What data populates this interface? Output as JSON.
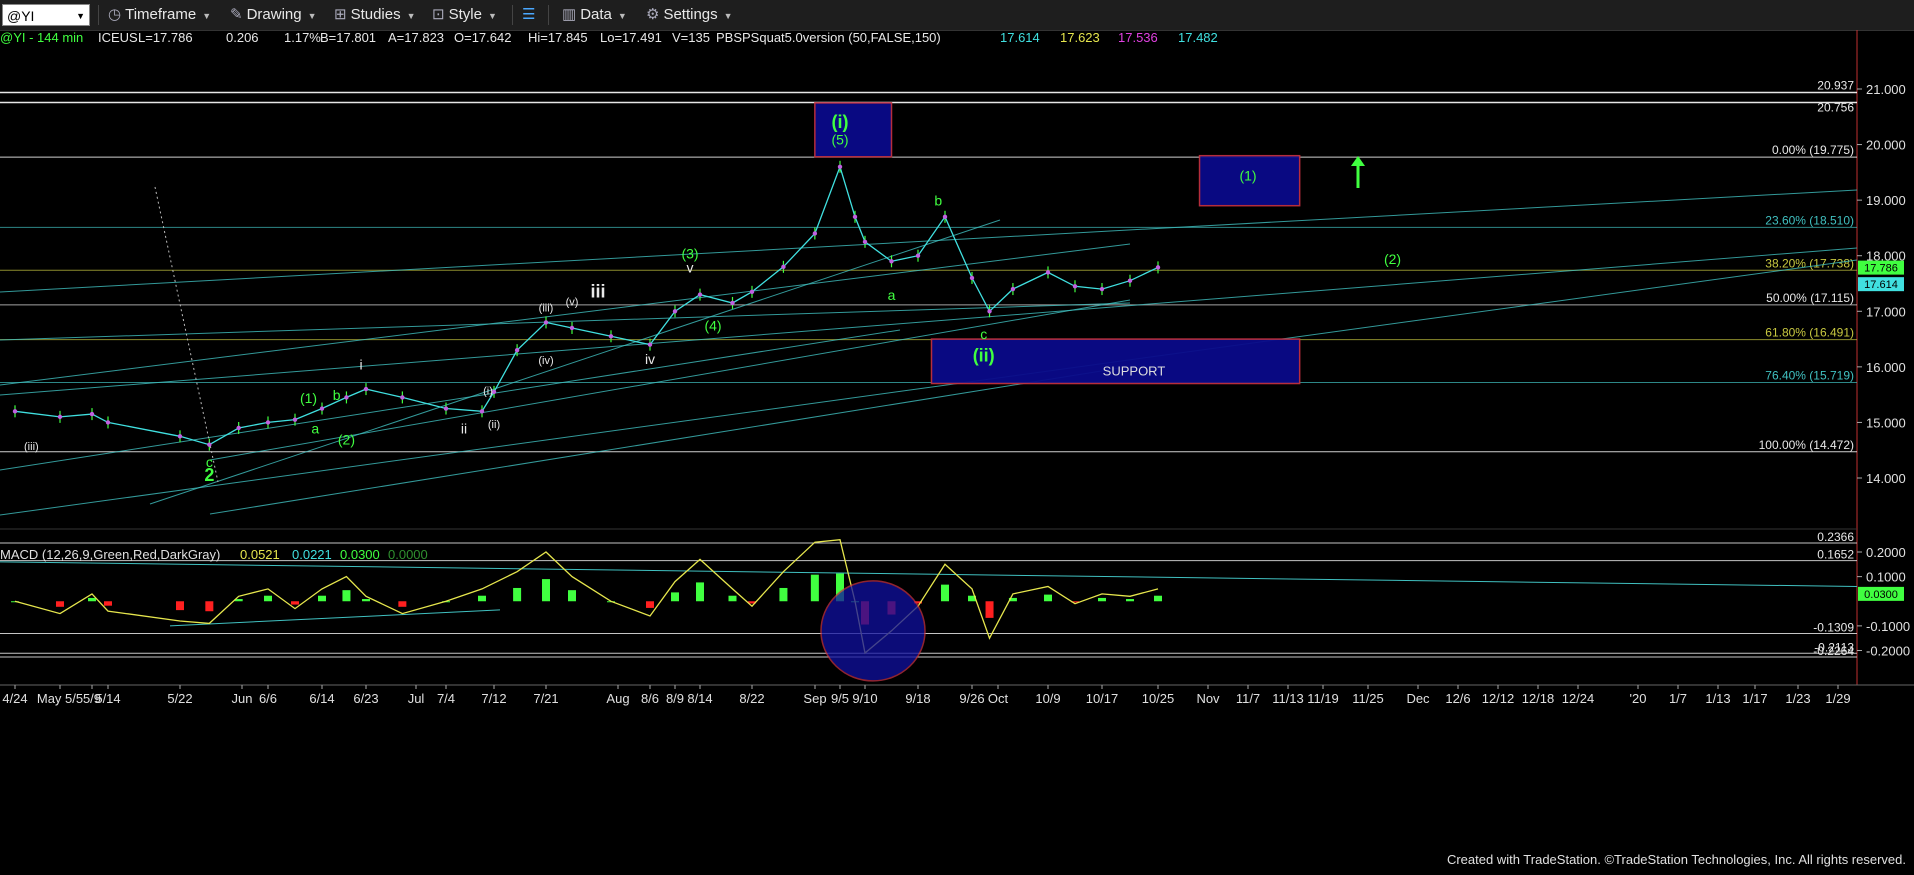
{
  "toolbar": {
    "symbol": "@YI",
    "timeframe_label": "Timeframe",
    "drawing_label": "Drawing",
    "studies_label": "Studies",
    "style_label": "Style",
    "data_label": "Data",
    "settings_label": "Settings"
  },
  "header": {
    "symbol_info": "@YI - 144 min",
    "exchange": "ICEUS",
    "last": "L=17.786",
    "change": "0.206",
    "change_pct": "1.17%",
    "bid": "B=17.801",
    "ask": "A=17.823",
    "open": "O=17.642",
    "high": "Hi=17.845",
    "low": "Lo=17.491",
    "volume": "V=135",
    "indicator": "PBSPSquat5.0version (50,FALSE,150)",
    "ind_values": [
      "17.614",
      "17.623",
      "17.536",
      "17.482"
    ],
    "ind_colors": [
      "#40e0e0",
      "#e6e64d",
      "#e040e0",
      "#40e0e0"
    ]
  },
  "macd_header": {
    "label": "MACD (12,26,9,Green,Red,DarkGray)",
    "values": [
      "0.0521",
      "0.0221",
      "0.0300",
      "0.0000"
    ],
    "colors": [
      "#e6e64d",
      "#40e0e0",
      "#40ff40",
      "#2f8f2f"
    ]
  },
  "footer": "Created with TradeStation. ©TradeStation Technologies, Inc. All rights reserved.",
  "colors": {
    "background": "#000000",
    "price_bars": "#40e0e0",
    "wave_green": "#40ff40",
    "wave_white": "#e8e8e8",
    "trendline": "#40c0c0",
    "box_fill": "#0a0a8a",
    "macd_pos": "#40ff40",
    "macd_neg": "#ff2020"
  },
  "chart_data": [
    {
      "type": "line",
      "title": "@YI - 144 min",
      "x_tick_labels": [
        "4/24",
        "May 5/5",
        "5/9",
        "5/14",
        "5/22",
        "Jun",
        "6/6",
        "6/14",
        "6/23",
        "Jul",
        "7/4",
        "7/12",
        "7/21",
        "Aug",
        "8/6",
        "8/9",
        "8/14",
        "8/22",
        "Sep",
        "9/5",
        "9/10",
        "9/18",
        "9/26",
        "Oct",
        "10/9",
        "10/17",
        "10/25",
        "Nov",
        "11/7",
        "11/13",
        "11/19",
        "11/25",
        "Dec",
        "12/6",
        "12/12",
        "12/18",
        "12/24",
        "'20",
        "1/7",
        "1/13",
        "1/17",
        "1/23",
        "1/29"
      ],
      "y_tick_labels": [
        "21.000",
        "20.000",
        "19.000",
        "18.000",
        "17.000",
        "16.000",
        "15.000",
        "14.000"
      ],
      "ylim": [
        13.25,
        21.45
      ],
      "series": [
        {
          "x": [
            "4/24",
            "5/5",
            "5/9",
            "5/14",
            "5/22",
            "5/27",
            "6/1",
            "6/6",
            "6/10",
            "6/14",
            "6/19",
            "6/23",
            "6/28",
            "7/4",
            "7/10",
            "7/12",
            "7/16",
            "7/21",
            "7/25",
            "7/31",
            "8/6",
            "8/9",
            "8/14",
            "8/19",
            "8/22",
            "8/27",
            "9/1",
            "9/5",
            "9/8",
            "9/10",
            "9/14",
            "9/18",
            "9/22",
            "9/26",
            "9/29",
            "10/3",
            "10/9",
            "10/13",
            "10/17",
            "10/21",
            "10/25"
          ],
          "values": [
            15.2,
            15.1,
            15.15,
            15.0,
            14.75,
            14.6,
            14.9,
            15.0,
            15.05,
            15.25,
            15.45,
            15.6,
            15.45,
            15.25,
            15.2,
            15.55,
            16.3,
            16.8,
            16.7,
            16.55,
            16.4,
            17.0,
            17.3,
            17.15,
            17.35,
            17.8,
            18.4,
            19.6,
            18.7,
            18.25,
            17.9,
            18.0,
            18.7,
            17.6,
            17.0,
            17.4,
            17.7,
            17.45,
            17.4,
            17.55,
            17.79
          ]
        }
      ],
      "levels": [
        {
          "label": "20.937",
          "value": 20.937
        },
        {
          "label": "20.756",
          "value": 20.756
        },
        {
          "label": "0.00% (19.775)",
          "value": 19.775
        },
        {
          "label": "23.60% (18.510)",
          "value": 18.51
        },
        {
          "label": "38.20% (17.738)",
          "value": 17.738
        },
        {
          "label": "50.00% (17.115)",
          "value": 17.115
        },
        {
          "label": "61.80% (16.491)",
          "value": 16.491
        },
        {
          "label": "76.40% (15.719)",
          "value": 15.719
        },
        {
          "label": "100.00% (14.472)",
          "value": 14.472
        }
      ],
      "price_markers": [
        "17.786",
        "17.614"
      ],
      "boxes": [
        {
          "label": "(i)",
          "sublabel": "(5)",
          "x0": "9/1",
          "x1": "9/14",
          "y0": 19.78,
          "y1": 20.75
        },
        {
          "label": "(1)",
          "x0": "10/31",
          "x1": "11/15",
          "y0": 18.9,
          "y1": 19.8
        },
        {
          "label": "SUPPORT",
          "x0": "9/20",
          "x1": "11/15",
          "y0": 15.7,
          "y1": 16.5
        }
      ],
      "wave_labels": [
        {
          "text": "(iii)",
          "x": "4/28",
          "y": 14.5,
          "color": "white",
          "size": "small"
        },
        {
          "text": "c",
          "x": "5/27",
          "y": 14.2,
          "color": "green"
        },
        {
          "text": "2",
          "x": "5/27",
          "y": 13.95,
          "color": "green",
          "size": "big"
        },
        {
          "text": "(1)",
          "x": "6/12",
          "y": 15.35,
          "color": "green"
        },
        {
          "text": "a",
          "x": "6/13",
          "y": 14.8,
          "color": "green"
        },
        {
          "text": "b",
          "x": "6/17",
          "y": 15.4,
          "color": "green"
        },
        {
          "text": "(2)",
          "x": "6/19",
          "y": 14.6,
          "color": "green"
        },
        {
          "text": "i",
          "x": "6/22",
          "y": 15.95,
          "color": "white"
        },
        {
          "text": "(i)",
          "x": "7/11",
          "y": 15.5,
          "color": "white",
          "size": "small"
        },
        {
          "text": "ii",
          "x": "7/7",
          "y": 14.8,
          "color": "white"
        },
        {
          "text": "(ii)",
          "x": "7/12",
          "y": 14.9,
          "color": "white",
          "size": "small"
        },
        {
          "text": "(iii)",
          "x": "7/21",
          "y": 17.0,
          "color": "white",
          "size": "small"
        },
        {
          "text": "(iv)",
          "x": "7/21",
          "y": 16.05,
          "color": "white",
          "size": "small"
        },
        {
          "text": "(v)",
          "x": "7/25",
          "y": 17.1,
          "color": "white",
          "size": "small"
        },
        {
          "text": "iii",
          "x": "7/29",
          "y": 17.25,
          "color": "white",
          "size": "big"
        },
        {
          "text": "iv",
          "x": "8/6",
          "y": 16.05,
          "color": "white"
        },
        {
          "text": "(3)",
          "x": "8/12",
          "y": 17.95,
          "color": "green"
        },
        {
          "text": "v",
          "x": "8/12",
          "y": 17.7,
          "color": "white"
        },
        {
          "text": "(4)",
          "x": "8/16",
          "y": 16.65,
          "color": "green"
        },
        {
          "text": "(i)",
          "x": "9/5",
          "y": 20.3,
          "color": "green",
          "size": "big"
        },
        {
          "text": "(5)",
          "x": "9/5",
          "y": 20.0,
          "color": "green"
        },
        {
          "text": "a",
          "x": "9/14",
          "y": 17.2,
          "color": "green"
        },
        {
          "text": "b",
          "x": "9/21",
          "y": 18.9,
          "color": "green"
        },
        {
          "text": "c",
          "x": "9/28",
          "y": 16.5,
          "color": "green"
        },
        {
          "text": "(ii)",
          "x": "9/28",
          "y": 16.1,
          "color": "green",
          "size": "big"
        },
        {
          "text": "(1)",
          "x": "11/7",
          "y": 19.35,
          "color": "green"
        },
        {
          "text": "(2)",
          "x": "11/28",
          "y": 17.85,
          "color": "green"
        }
      ]
    },
    {
      "type": "line",
      "title": "MACD (12,26,9,Green,Red,DarkGray)",
      "y_tick_labels": [
        "0.2000",
        "0.1000",
        "-0.1000",
        "-0.2000"
      ],
      "ylim": [
        -0.22,
        0.25
      ],
      "levels": [
        {
          "label": "0.2366",
          "value": 0.2366
        },
        {
          "label": "0.1652",
          "value": 0.1652
        },
        {
          "label": "0.0300",
          "value": 0.03
        },
        {
          "label": "-0.1309",
          "value": -0.1309
        },
        {
          "label": "-0.2113",
          "value": -0.2113
        },
        {
          "label": "-0.2264",
          "value": -0.2264
        }
      ],
      "series": [
        {
          "name": "MACD",
          "x": [
            "4/24",
            "5/5",
            "5/9",
            "5/14",
            "5/22",
            "5/27",
            "6/1",
            "6/6",
            "6/10",
            "6/14",
            "6/19",
            "6/23",
            "6/28",
            "7/4",
            "7/10",
            "7/16",
            "7/21",
            "7/25",
            "7/31",
            "8/6",
            "8/9",
            "8/14",
            "8/19",
            "8/22",
            "8/27",
            "9/1",
            "9/5",
            "9/8",
            "9/10",
            "9/14",
            "9/18",
            "9/22",
            "9/26",
            "9/29",
            "10/3",
            "10/9",
            "10/13",
            "10/17",
            "10/21",
            "10/25"
          ],
          "values": [
            0.0,
            -0.05,
            0.03,
            -0.04,
            -0.08,
            -0.09,
            0.02,
            0.05,
            -0.03,
            0.05,
            0.1,
            0.02,
            -0.05,
            0.0,
            0.05,
            0.12,
            0.2,
            0.1,
            0.0,
            -0.06,
            0.08,
            0.17,
            0.05,
            -0.02,
            0.12,
            0.24,
            0.25,
            0.0,
            -0.21,
            -0.12,
            -0.02,
            0.15,
            0.05,
            -0.15,
            0.03,
            0.06,
            -0.01,
            0.03,
            0.02,
            0.05
          ]
        }
      ]
    }
  ]
}
